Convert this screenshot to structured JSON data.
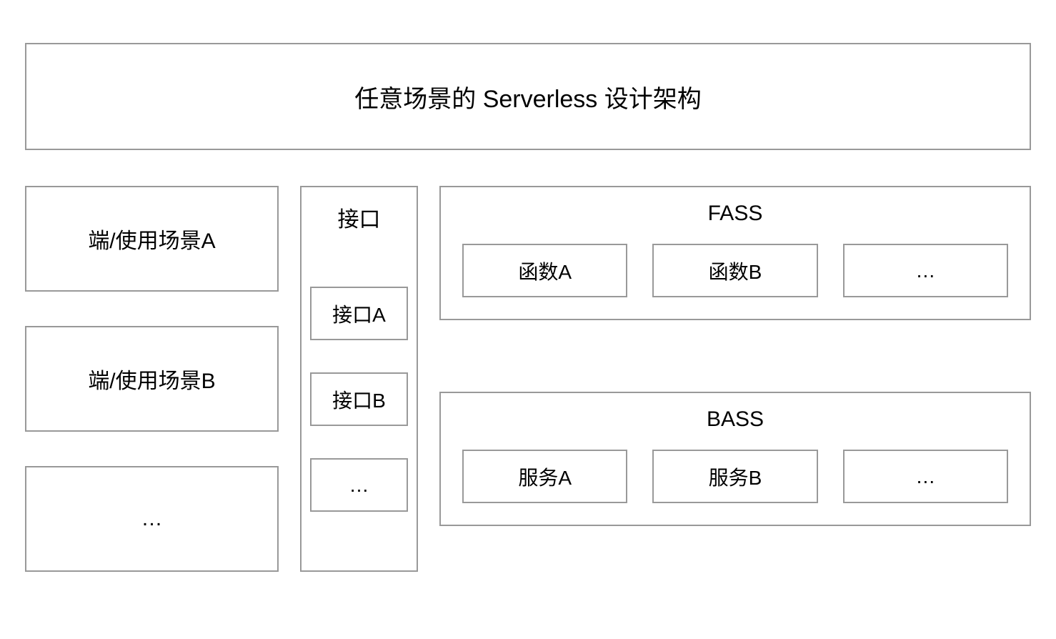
{
  "title": "任意场景的 Serverless 设计架构",
  "scenarios": {
    "items": [
      "端/使用场景A",
      "端/使用场景B",
      "…"
    ]
  },
  "interface": {
    "title": "接口",
    "items": [
      "接口A",
      "接口B",
      "…"
    ]
  },
  "fass": {
    "title": "FASS",
    "items": [
      "函数A",
      "函数B",
      "…"
    ]
  },
  "bass": {
    "title": "BASS",
    "items": [
      "服务A",
      "服务B",
      "…"
    ]
  }
}
